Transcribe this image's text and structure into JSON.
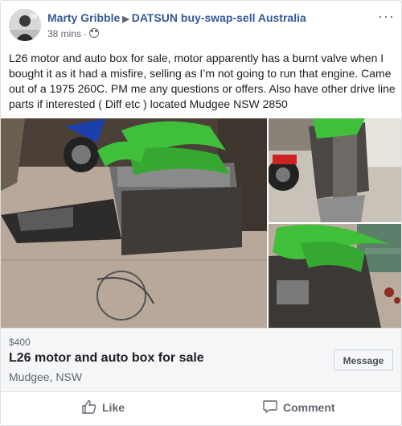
{
  "post": {
    "author": "Marty Gribble",
    "group": "DATSUN buy-swap-sell Australia",
    "time": "38 mins",
    "audience_icon": "group-icon",
    "more_label": "···",
    "body": "L26 motor and auto box for sale, motor apparently has a burnt valve when I bought it as it had a misfire, selling as I’m not going to run that engine. Came out of a 1975 260C. PM me any questions or offers. Also have other drive line parts if interested ( Diff etc ) located Mudgee NSW 2850"
  },
  "listing": {
    "price": "$400",
    "title": "L26 motor and auto box for sale",
    "location": "Mudgee, NSW",
    "message_label": "Message"
  },
  "actions": {
    "like_label": "Like",
    "comment_label": "Comment"
  },
  "colors": {
    "author_link": "#385898",
    "listing_bg": "#f5f6f7",
    "strap_green": "#3fbf3a"
  }
}
